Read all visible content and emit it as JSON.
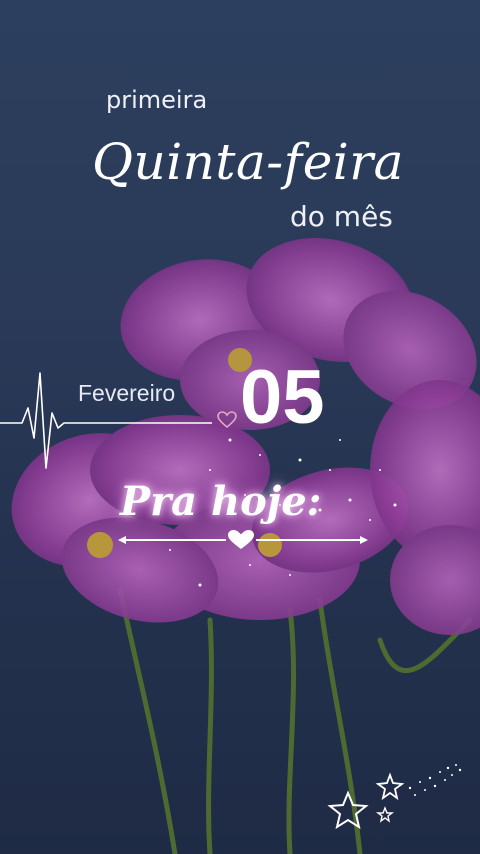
{
  "texts": {
    "primeira": "primeira",
    "weekday": "Quinta-feira",
    "do_mes": "do mês",
    "month": "Fevereiro",
    "day": "05",
    "pra_hoje": "Pra hoje:"
  },
  "icons": {
    "heartbeat": "heartbeat-line-icon",
    "small_heart": "heart-outline-icon",
    "divider_heart": "heart-icon",
    "stars": "stars-icon"
  },
  "colors": {
    "sky_top": "#2d3f5e",
    "sky_bottom": "#1f2b45",
    "petal": "#8a3c93",
    "petal_light": "#b15fb9",
    "stem": "#4a6b2f",
    "text": "#ffffff"
  }
}
